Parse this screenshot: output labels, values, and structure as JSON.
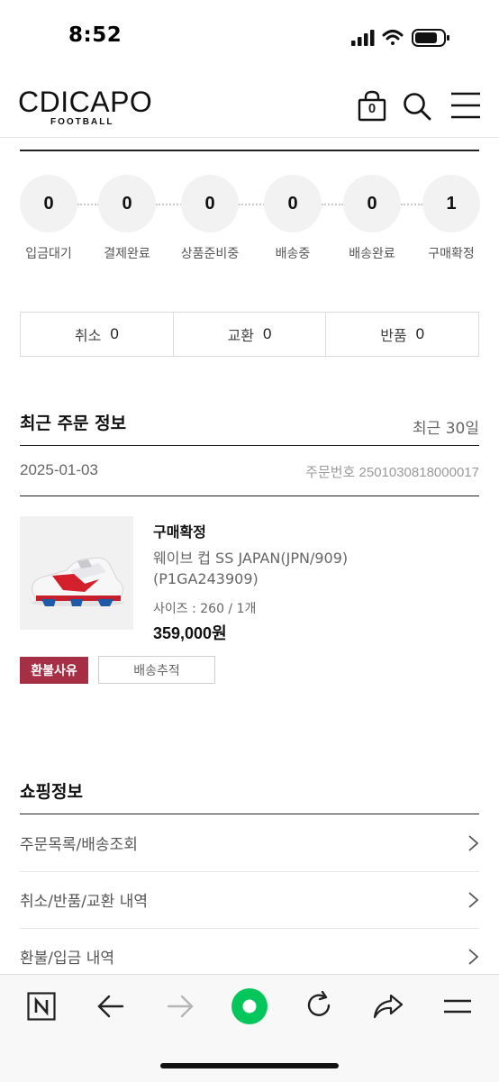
{
  "status_bar": {
    "time": "8:52",
    "icons": [
      "signal-icon",
      "wifi-icon",
      "battery-icon"
    ]
  },
  "header": {
    "logo_main": "CDICAPO",
    "logo_sub": "FOOTBALL",
    "cart_count": "0",
    "icons": [
      "cart-icon",
      "search-icon",
      "menu-icon"
    ]
  },
  "order_steps": [
    {
      "count": "0",
      "label": "입금대기"
    },
    {
      "count": "0",
      "label": "결제완료"
    },
    {
      "count": "0",
      "label": "상품준비중"
    },
    {
      "count": "0",
      "label": "배송중"
    },
    {
      "count": "0",
      "label": "배송완료"
    },
    {
      "count": "1",
      "label": "구매확정"
    }
  ],
  "claims": [
    {
      "label": "취소",
      "count": "0"
    },
    {
      "label": "교환",
      "count": "0"
    },
    {
      "label": "반품",
      "count": "0"
    }
  ],
  "recent_orders": {
    "title": "최근 주문 정보",
    "period": "최근 30일",
    "order_date": "2025-01-03",
    "order_number": "주문번호 2501030818000017",
    "product": {
      "status": "구매확정",
      "name_line1": "웨이브 컵 SS JAPAN(JPN/909)",
      "name_line2": "(P1GA243909)",
      "option": "사이즈 : 260 / 1개",
      "price": "359,000원"
    },
    "buttons": {
      "refund_reason": "환불사유",
      "track_shipping": "배송추적"
    }
  },
  "shopping_info": {
    "title": "쇼핑정보",
    "items": [
      "주문목록/배송조회",
      "취소/반품/교환 내역",
      "환불/입금 내역"
    ]
  },
  "browser_bar": {
    "icons": [
      "naver-n-icon",
      "back-arrow-icon",
      "forward-arrow-icon",
      "green-dot-home-icon",
      "reload-icon",
      "share-icon",
      "hamburger-icon"
    ]
  },
  "colors": {
    "accent_refund": "#a62e45",
    "browser_green": "#03c75a",
    "text_dark": "#111111",
    "text_muted": "#666666"
  }
}
